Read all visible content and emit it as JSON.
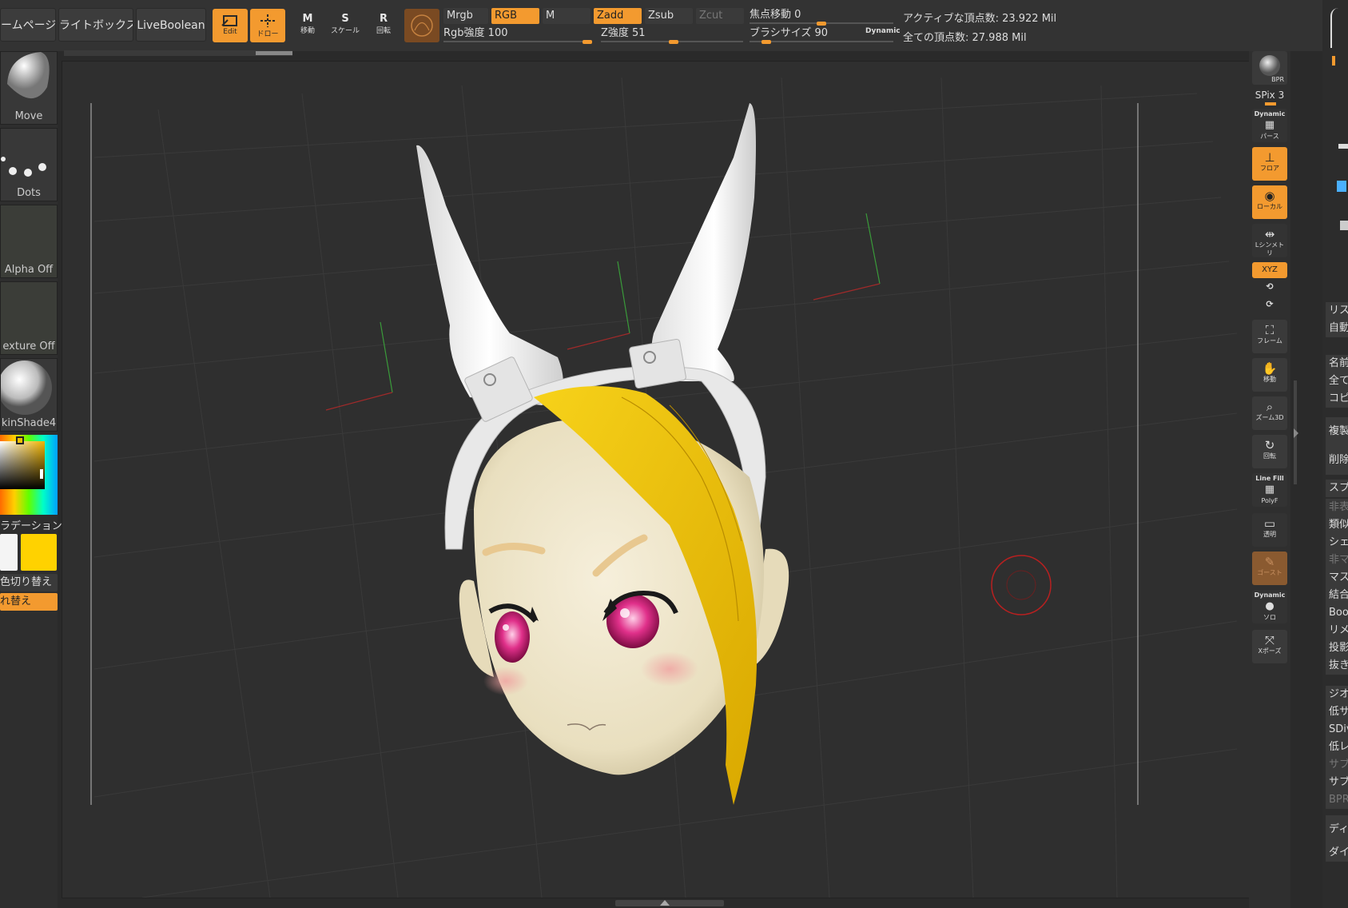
{
  "colors": {
    "accent": "#f39a2f",
    "hair": "#f2c200",
    "skin": "#efe6cc",
    "bg": "#2f2f2f"
  },
  "top": {
    "home_page": "ームページ",
    "lightbox": "ライトボックス",
    "liveboolean": "LiveBoolean",
    "edit": "Edit",
    "draw": "ドロー",
    "move": "移動",
    "scale": "スケール",
    "rotate": "回転",
    "move_glyph": "M",
    "scale_glyph": "S",
    "rotate_glyph": "R",
    "mrgb": "Mrgb",
    "rgb": "RGB",
    "m": "M",
    "zadd": "Zadd",
    "zsub": "Zsub",
    "zcut": "Zcut",
    "rgb_intensity": "Rgb強度 100",
    "rgb_intensity_value": 100,
    "z_intensity": "Z強度 51",
    "z_intensity_value": 51,
    "focal_shift": "焦点移動 0",
    "focal_shift_value": 0,
    "brush_size": "ブラシサイズ 90",
    "brush_size_value": 90,
    "dynamic": "Dynamic",
    "active_points": "アクティブな頂点数: 23.922 Mil",
    "total_points": "全ての頂点数: 27.988 Mil"
  },
  "left": {
    "move_brush": "Move",
    "dots": "Dots",
    "alpha_off": "Alpha Off",
    "texture_off": "exture Off",
    "material": "kinShade4",
    "gradient": "ラデーション",
    "switch_color": "色切り替え",
    "swap": "れ替え"
  },
  "shelf": {
    "bpr": "BPR",
    "spix": "SPix 3",
    "dynamic": "Dynamic",
    "perspective": "パース",
    "floor": "フロア",
    "local": "ローカル",
    "symmetry": "Lシンメトリ",
    "xyz": "XYZ",
    "frame": "フレーム",
    "move": "移動",
    "zoom3d": "ズーム3D",
    "rotate": "回転",
    "linefill": "Line Fill",
    "polyf": "PolyF",
    "transp": "透明",
    "ghost": "ゴースト",
    "dynamic2": "Dynamic",
    "solo": "ソロ",
    "xpose": "Xポーズ"
  },
  "rpanel": {
    "items": [
      "リス",
      "自動",
      "名前",
      "全て",
      "コピ",
      "複製",
      "削除",
      "スプ",
      "非表",
      "類似",
      "シェ",
      "非マ",
      "マス",
      "結合",
      "Boo",
      "リメ",
      "投影",
      "抜き",
      "ジオ",
      "低サ",
      "SDiv",
      "低レ",
      "サブ",
      "サブ",
      "BPR",
      "ディ",
      "ダイ"
    ]
  }
}
